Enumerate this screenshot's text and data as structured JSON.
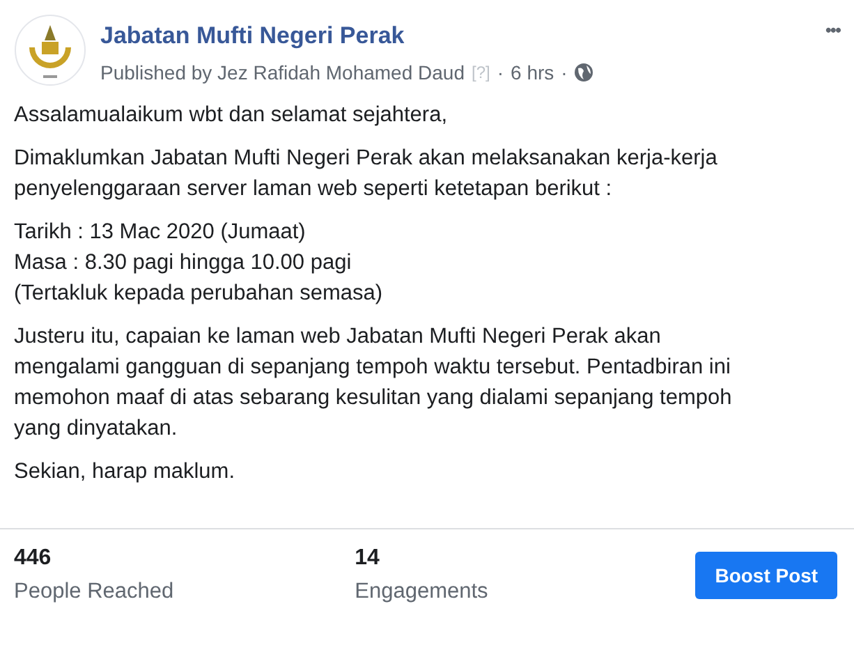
{
  "post": {
    "page_name": "Jabatan Mufti Negeri Perak",
    "published_by": "Published by Jez Rafidah Mohamed Daud",
    "help_mark": "[?]",
    "separator": "·",
    "time": "6 hrs",
    "separator_2": "·",
    "more": "•••"
  },
  "paragraphs": [
    {
      "lines": [
        "Assalamualaikum wbt dan selamat sejahtera,"
      ]
    },
    {
      "lines": [
        "Dimaklumkan Jabatan Mufti Negeri Perak akan melaksanakan kerja-kerja",
        "penyelenggaraan server laman web seperti ketetapan berikut :"
      ]
    },
    {
      "lines": [
        "Tarikh : 13 Mac 2020 (Jumaat)",
        "Masa : 8.30 pagi hingga 10.00 pagi",
        "(Tertakluk kepada perubahan semasa)"
      ]
    },
    {
      "lines": [
        "Justeru itu, capaian ke laman web Jabatan Mufti Negeri Perak akan",
        "mengalami gangguan di sepanjang tempoh waktu tersebut. Pentadbiran ini",
        "memohon maaf di atas sebarang kesulitan yang dialami sepanjang tempoh",
        "yang dinyatakan."
      ]
    },
    {
      "lines": [
        "Sekian, harap maklum."
      ]
    }
  ],
  "stats": [
    {
      "value": "446",
      "label": "People Reached"
    },
    {
      "value": "14",
      "label": "Engagements"
    }
  ],
  "boost_button": "Boost Post"
}
